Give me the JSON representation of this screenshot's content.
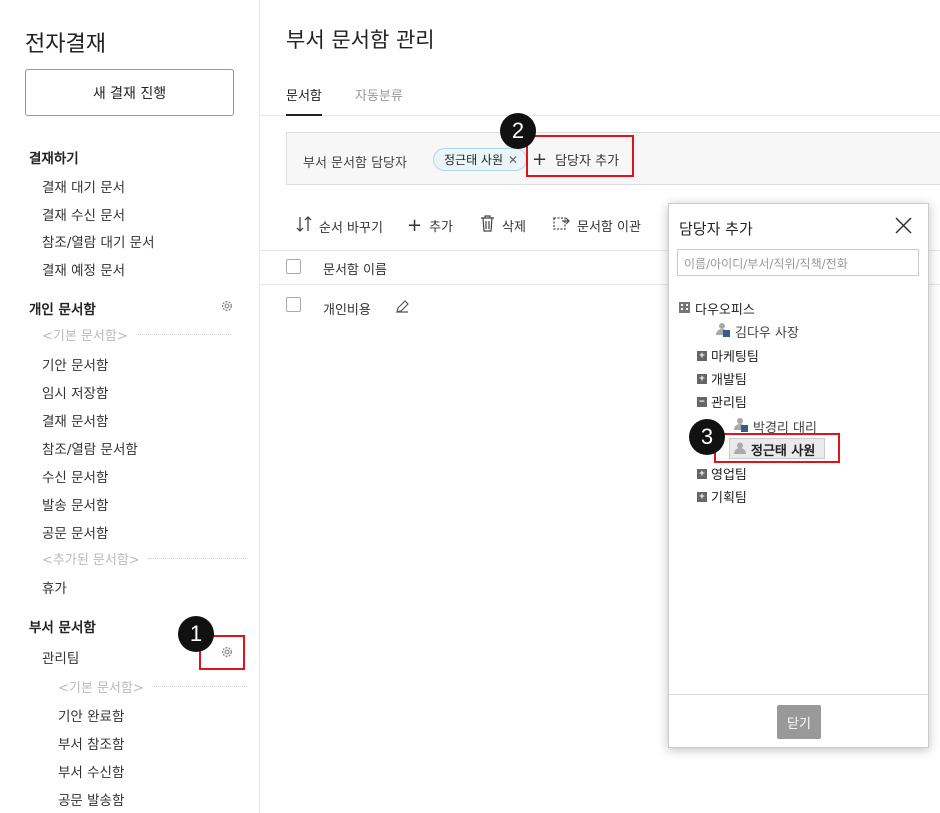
{
  "sidebar": {
    "app_title": "전자결재",
    "new_button": "새 결재 진행",
    "sections": {
      "approve": {
        "title": "결재하기",
        "items": [
          "결재 대기 문서",
          "결재 수신 문서",
          "참조/열람 대기 문서",
          "결재 예정 문서"
        ]
      },
      "personal": {
        "title": "개인 문서함",
        "basic_placeholder": "<기본 문서함>",
        "items": [
          "기안 문서함",
          "임시 저장함",
          "결재 문서함",
          "참조/열람 문서함",
          "수신 문서함",
          "발송 문서함",
          "공문 문서함"
        ],
        "added_placeholder": "<추가된 문서함>",
        "added_items": [
          "휴가"
        ]
      },
      "dept": {
        "title": "부서 문서함",
        "team": "관리팀",
        "basic_placeholder": "<기본 문서함>",
        "items": [
          "기안 완료함",
          "부서 참조함",
          "부서 수신함",
          "공문 발송함"
        ]
      }
    }
  },
  "main": {
    "title": "부서 문서함 관리",
    "tabs": [
      "문서함",
      "자동분류"
    ],
    "manager_label": "부서 문서함 담당자",
    "manager_chip": "정근태 사원",
    "add_manager": "담당자 추가",
    "toolbar": {
      "reorder": "순서 바꾸기",
      "add": "추가",
      "delete": "삭제",
      "transfer": "문서함 이관"
    },
    "table": {
      "header": "문서함 이름",
      "rows": [
        "개인비용"
      ]
    }
  },
  "popup": {
    "title": "담당자 추가",
    "search_placeholder": "이름/아이디/부서/직위/직책/전화",
    "tree": {
      "root": "다우오피스",
      "ceo": "김다우 사장",
      "teams": [
        "마케팅팀",
        "개발팀",
        "관리팀",
        "영업팀",
        "기획팀"
      ],
      "mgmt_members": [
        "박경리 대리",
        "정근태 사원"
      ]
    },
    "close_button": "닫기"
  },
  "annotations": [
    "1",
    "2",
    "3"
  ],
  "colors": {
    "highlight": "#e0121c",
    "chip_bg": "#eaf5fa"
  }
}
